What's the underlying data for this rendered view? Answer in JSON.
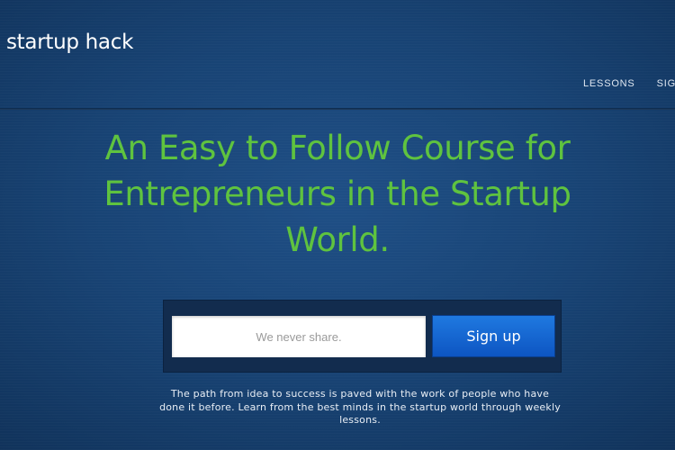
{
  "header": {
    "logo_text": "startup hack",
    "nav": {
      "items": [
        "LESSONS",
        "SIGN"
      ]
    }
  },
  "hero": {
    "headline": "An Easy to Follow Course for Entrepreneurs in the Startup World."
  },
  "signup": {
    "email_placeholder": "We never share.",
    "button_label": "Sign up"
  },
  "tagline": "The path from idea to success is paved with the work of people who have done it before. Learn from the best minds in the startup world through weekly lessons.",
  "colors": {
    "background": "#184374",
    "headline_green": "#5fc33f",
    "button_blue": "#1565d0"
  }
}
